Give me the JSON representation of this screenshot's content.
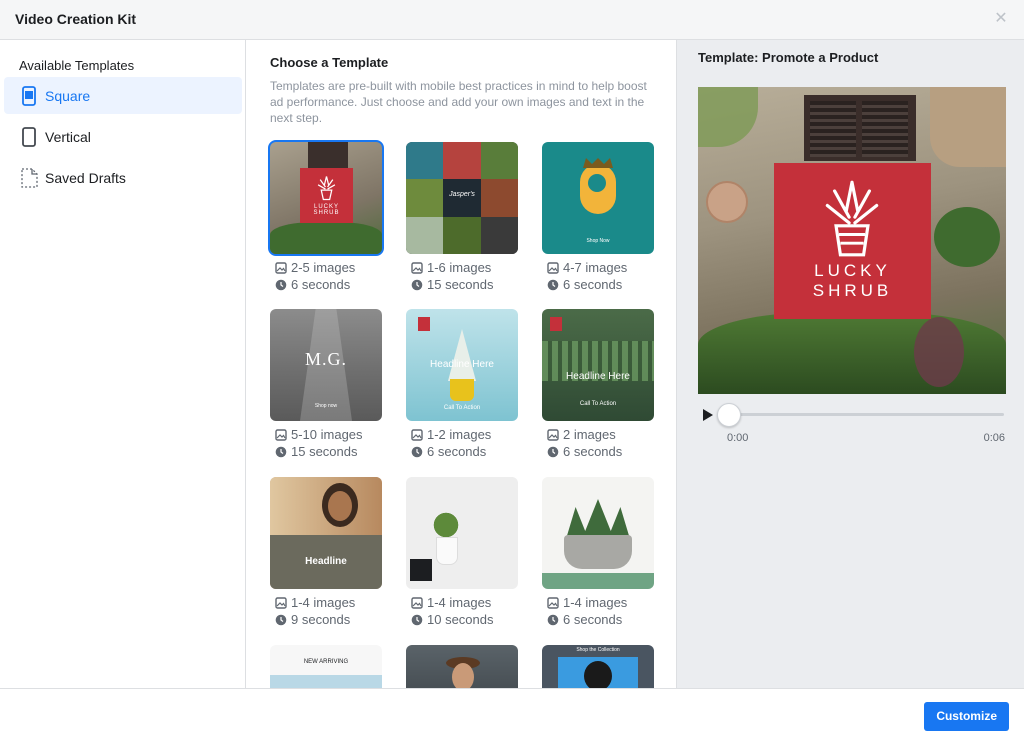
{
  "window": {
    "title": "Video Creation Kit"
  },
  "sidebar": {
    "heading": "Available Templates",
    "items": [
      {
        "label": "Square",
        "icon": "square-phone-icon",
        "active": true
      },
      {
        "label": "Vertical",
        "icon": "vertical-phone-icon",
        "active": false
      },
      {
        "label": "Saved Drafts",
        "icon": "document-icon",
        "active": false
      }
    ]
  },
  "main": {
    "title": "Choose a Template",
    "description": "Templates are pre-built with mobile best practices in mind to help boost ad performance. Just choose and add your own images and text in the next step.",
    "templates": [
      {
        "images": "2-5 images",
        "seconds": "6 seconds",
        "overlay": "LUCKY SHRUB",
        "selected": true
      },
      {
        "images": "1-6 images",
        "seconds": "15 seconds",
        "overlay": "Jasper's"
      },
      {
        "images": "4-7 images",
        "seconds": "6 seconds",
        "overlay": "Shop Now"
      },
      {
        "images": "5-10 images",
        "seconds": "15 seconds",
        "overlay": "M.G.",
        "overlay2": "Shop now"
      },
      {
        "images": "1-2 images",
        "seconds": "6 seconds",
        "overlay": "Headline Here",
        "overlay2": "Call To Action"
      },
      {
        "images": "2 images",
        "seconds": "6 seconds",
        "overlay": "Headline Here",
        "overlay2": "Call To Action"
      },
      {
        "images": "1-4 images",
        "seconds": "9 seconds",
        "overlay": "Headline"
      },
      {
        "images": "1-4 images",
        "seconds": "10 seconds"
      },
      {
        "images": "1-4 images",
        "seconds": "6 seconds"
      },
      {
        "overlay": "NEW ARRIVING"
      },
      {},
      {
        "overlay": "Shop the Collection"
      }
    ]
  },
  "preview": {
    "title": "Template: Promote a Product",
    "brand": "LUCKY SHRUB",
    "time_start": "0:00",
    "time_end": "0:06",
    "progress": 0
  },
  "footer": {
    "customize_label": "Customize"
  },
  "colors": {
    "accent": "#1877f2",
    "brand_red": "#c4303a"
  }
}
